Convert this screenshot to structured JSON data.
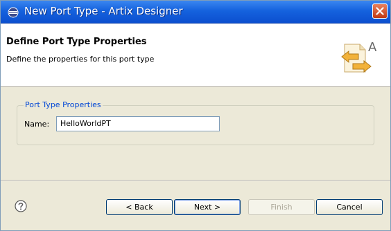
{
  "window": {
    "title": "New Port Type - Artix Designer",
    "icons": {
      "app": "eclipse-icon",
      "close": "close-icon"
    }
  },
  "header": {
    "title": "Define Port Type Properties",
    "description": "Define the properties for this port type",
    "icon": "port-type-wizard-icon",
    "icon_letter": "A"
  },
  "group": {
    "legend": "Port Type Properties",
    "name_label": "Name:",
    "name_value": "HelloWorldPT"
  },
  "footer": {
    "help_icon": "help-icon",
    "back_label": "< Back",
    "next_label": "Next >",
    "finish_label": "Finish",
    "cancel_label": "Cancel"
  },
  "colors": {
    "titlebar": "#1562de",
    "close_button": "#d6542d",
    "group_legend": "#0046d5",
    "dialog_background": "#ece9d8"
  }
}
